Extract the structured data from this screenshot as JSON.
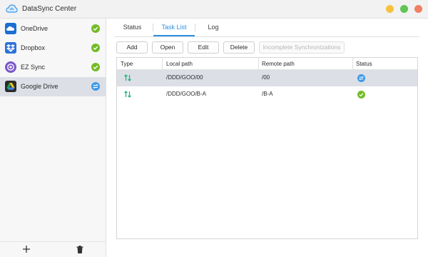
{
  "window": {
    "title": "DataSync Center",
    "app_icon": "cloud-sync-icon",
    "controls": [
      "minimize",
      "maximize",
      "close"
    ]
  },
  "sidebar": {
    "items": [
      {
        "label": "OneDrive",
        "icon": "onedrive-icon",
        "status": "check-icon",
        "active": false
      },
      {
        "label": "Dropbox",
        "icon": "dropbox-icon",
        "status": "check-icon",
        "active": false
      },
      {
        "label": "EZ Sync",
        "icon": "ez-sync-icon",
        "status": "check-icon",
        "active": false
      },
      {
        "label": "Google Drive",
        "icon": "google-drive-icon",
        "status": "syncing-icon",
        "active": true
      }
    ],
    "bottom": {
      "add": "+",
      "delete": "trash-icon"
    }
  },
  "tabs": [
    {
      "label": "Status",
      "active": false
    },
    {
      "label": "Task List",
      "active": true
    },
    {
      "label": "Log",
      "active": false
    }
  ],
  "toolbar": {
    "add": "Add",
    "open": "Open",
    "edit": "Edit",
    "delete": "Delete",
    "incomplete": "Incomplete Synchronizations"
  },
  "table": {
    "columns": [
      "Type",
      "Local path",
      "Remote path",
      "Status"
    ],
    "rows": [
      {
        "type": "two-way-sync-icon",
        "local": "/DDD/GOO/00",
        "remote": "/00",
        "status": "syncing-icon",
        "selected": true
      },
      {
        "type": "two-way-sync-icon",
        "local": "/DDD/GOO/B-A",
        "remote": "/B-A",
        "status": "check-icon",
        "selected": false
      }
    ]
  },
  "colors": {
    "accent": "#2f8fe0",
    "ok": "#74bb28",
    "sync": "#3d9ae8",
    "type_icon": "#27b37a"
  }
}
